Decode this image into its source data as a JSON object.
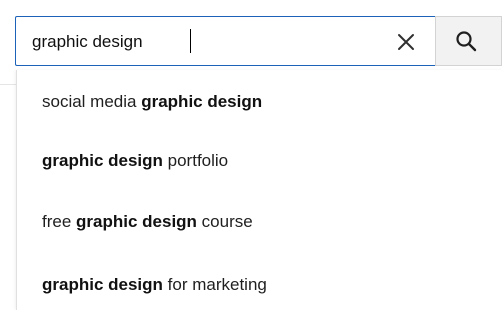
{
  "search": {
    "query": "graphic design",
    "clear_icon": "close-icon",
    "search_icon": "search-icon"
  },
  "suggestions": [
    {
      "prefix": "social media ",
      "bold": "graphic design",
      "suffix": ""
    },
    {
      "prefix": "",
      "bold": "graphic design",
      "suffix": " portfolio"
    },
    {
      "prefix": "free ",
      "bold": "graphic design",
      "suffix": " course"
    },
    {
      "prefix": "",
      "bold": "graphic design",
      "suffix": " for marketing"
    }
  ],
  "colors": {
    "focus_border": "#1c62b9",
    "search_button_bg": "#f2f2f2"
  }
}
